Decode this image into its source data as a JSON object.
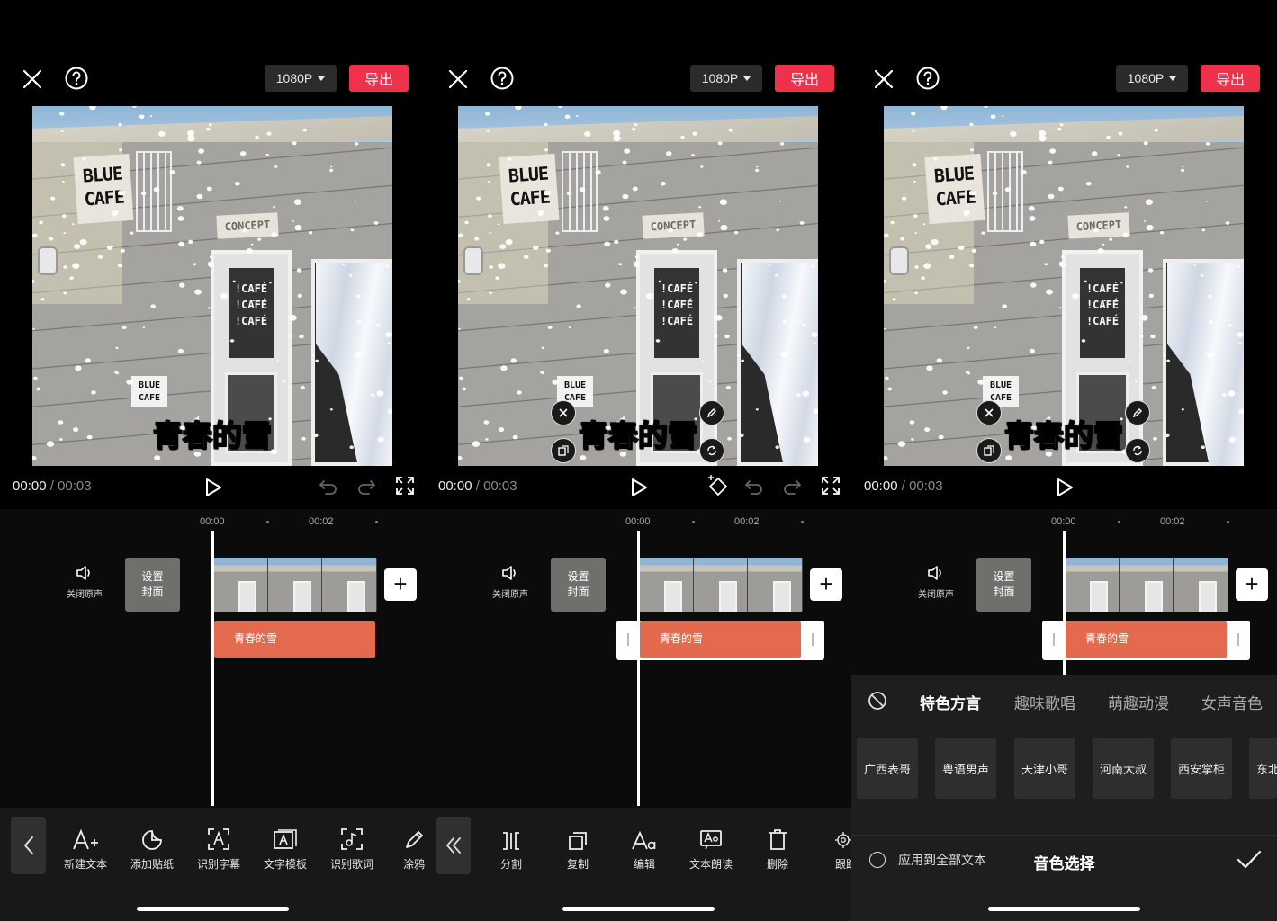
{
  "header": {
    "resolution_label": "1080P",
    "export_label": "导出"
  },
  "preview": {
    "caption_text": "青春的雪",
    "sign_text_1": "BLUE",
    "sign_text_2": "CAFE",
    "concept_sign": "CONCEPT",
    "door_text": [
      "!CAFÉ",
      "!CAFÉ",
      "!CAFÉ"
    ],
    "small_sign_1": "BLUE",
    "small_sign_2": "CAFE"
  },
  "playback": {
    "current_time": "00:00",
    "separator": "/",
    "total_time": "00:03"
  },
  "timeline": {
    "ruler_ticks": [
      "00:00",
      "00:02"
    ],
    "mute_label": "关闭原声",
    "cover_label_1": "设置",
    "cover_label_2": "封面",
    "text_clip_label": "青春的雪",
    "add_clip_label": "+"
  },
  "toolbar_main": {
    "items": [
      {
        "label": "新建文本",
        "icon": "add-text-icon"
      },
      {
        "label": "添加贴纸",
        "icon": "sticker-icon"
      },
      {
        "label": "识别字幕",
        "icon": "recognize-subtitle-icon"
      },
      {
        "label": "文字模板",
        "icon": "text-template-icon"
      },
      {
        "label": "识别歌词",
        "icon": "recognize-lyrics-icon"
      },
      {
        "label": "涂鸦",
        "icon": "doodle-icon"
      }
    ]
  },
  "toolbar_edit": {
    "items": [
      {
        "label": "分割",
        "icon": "split-icon"
      },
      {
        "label": "复制",
        "icon": "copy-icon"
      },
      {
        "label": "编辑",
        "icon": "edit-text-icon"
      },
      {
        "label": "文本朗读",
        "icon": "text-to-speech-icon"
      },
      {
        "label": "删除",
        "icon": "delete-icon"
      },
      {
        "label": "跟踪",
        "icon": "tracking-icon"
      }
    ]
  },
  "voice_panel": {
    "tabs": [
      "特色方言",
      "趣味歌唱",
      "萌趣动漫",
      "女声音色"
    ],
    "active_tab": "特色方言",
    "voices": [
      "广西表哥",
      "粤语男声",
      "天津小哥",
      "河南大叔",
      "西安掌柜",
      "东北"
    ],
    "apply_all_label": "应用到全部文本",
    "title": "音色选择"
  },
  "colors": {
    "export_red": "#f0314c",
    "text_track": "#e36a4e",
    "background": "#000000"
  }
}
